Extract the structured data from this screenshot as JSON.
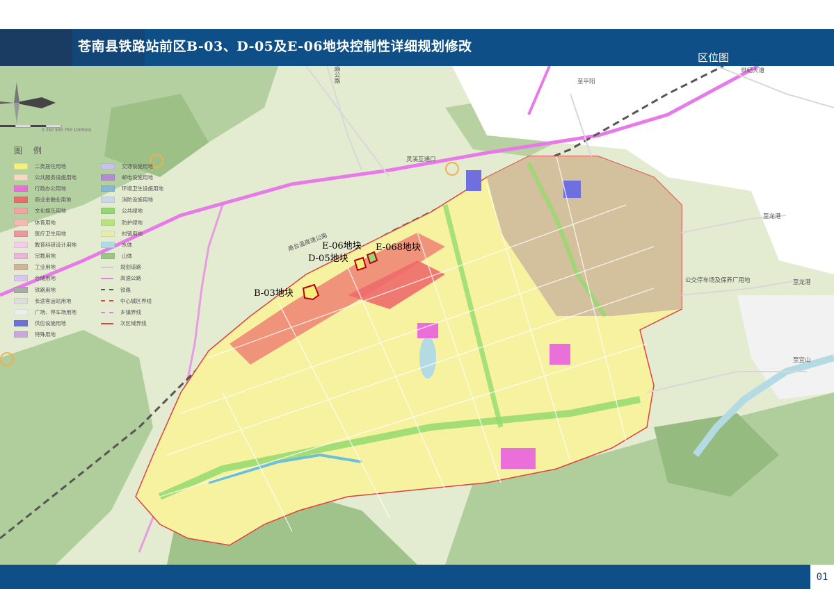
{
  "header": {
    "title": "苍南县铁路站前区B-03、D-05及E-06地块控制性详细规划修改",
    "subtitle": "区位图"
  },
  "footer": {
    "page_number": "01"
  },
  "legend": {
    "title": "图 例",
    "column1": [
      {
        "label": "二类居住用地",
        "color": "#f5f07a"
      },
      {
        "label": "公共服务设施用地",
        "color": "#f6d9c4"
      },
      {
        "label": "行政办公用地",
        "color": "#ea6fd8"
      },
      {
        "label": "商业金融业用地",
        "color": "#ee6b6b"
      },
      {
        "label": "文化娱乐用地",
        "color": "#f2a3a3"
      },
      {
        "label": "体育用地",
        "color": "#f3b9b6"
      },
      {
        "label": "医疗卫生用地",
        "color": "#e89aa3"
      },
      {
        "label": "教育科研设计用地",
        "color": "#f1cfe6"
      },
      {
        "label": "宗教用地",
        "color": "#e8b6d8"
      },
      {
        "label": "工业用地",
        "color": "#cdb79c"
      },
      {
        "label": "仓储用地",
        "color": "#d9c8ec"
      },
      {
        "label": "铁路用地",
        "color": "#aaaaaa"
      },
      {
        "label": "长途客运站用地",
        "color": "#dddddd"
      },
      {
        "label": "广场、停车场用地",
        "color": "#eeeeee"
      },
      {
        "label": "供应设施用地",
        "color": "#6f6fe0"
      },
      {
        "label": "特殊用地",
        "color": "#c9a7df"
      }
    ],
    "column2": [
      {
        "label": "交通设施用地",
        "color": "#c6c1ee",
        "style": "fill"
      },
      {
        "label": "邮电设施用地",
        "color": "#b48ad9",
        "style": "fill"
      },
      {
        "label": "环境卫生设施用地",
        "color": "#86b7d8",
        "style": "fill"
      },
      {
        "label": "消防设施用地",
        "color": "#c6d8ea",
        "style": "fill"
      },
      {
        "label": "公共绿地",
        "color": "#93d96f",
        "style": "fill"
      },
      {
        "label": "防护绿地",
        "color": "#b8e27f",
        "style": "fill"
      },
      {
        "label": "村镇用地",
        "color": "#e3ecb2",
        "style": "fill"
      },
      {
        "label": "水体",
        "color": "#b4dbe3",
        "style": "fill"
      },
      {
        "label": "山体",
        "color": "#9fc48b",
        "style": "fill"
      },
      {
        "label": "规划道路",
        "color": "#cccccc",
        "style": "line"
      },
      {
        "label": "高速公路",
        "color": "#e879e8",
        "style": "line"
      },
      {
        "label": "铁路",
        "color": "#555555",
        "style": "dash"
      },
      {
        "label": "中心城区界线",
        "color": "#e04040",
        "style": "dash"
      },
      {
        "label": "乡镇界线",
        "color": "#e080e0",
        "style": "dash"
      },
      {
        "label": "次区域界线",
        "color": "#e04040",
        "style": "line"
      }
    ]
  },
  "map": {
    "parcels": {
      "b03": "B-03地块",
      "d05": "D-05地块",
      "e06": "E-06地块",
      "e068": "E-068地块"
    },
    "place_labels": {
      "shiji_avenue": "世纪大道",
      "zhi_pingyang": "至平阳",
      "zhi_longgang_1": "至龙港",
      "zhi_longgang_2": "至龙港",
      "zhi_yishan": "至宜山",
      "lingxi_interchange": "灵溪互通口",
      "yongtai_expressway": "甬台温高速公路",
      "ma_road": "麻公路",
      "bus_station": "公交停车场及保养厂用地"
    },
    "scale": "0  250  500  750  1000(m)"
  }
}
